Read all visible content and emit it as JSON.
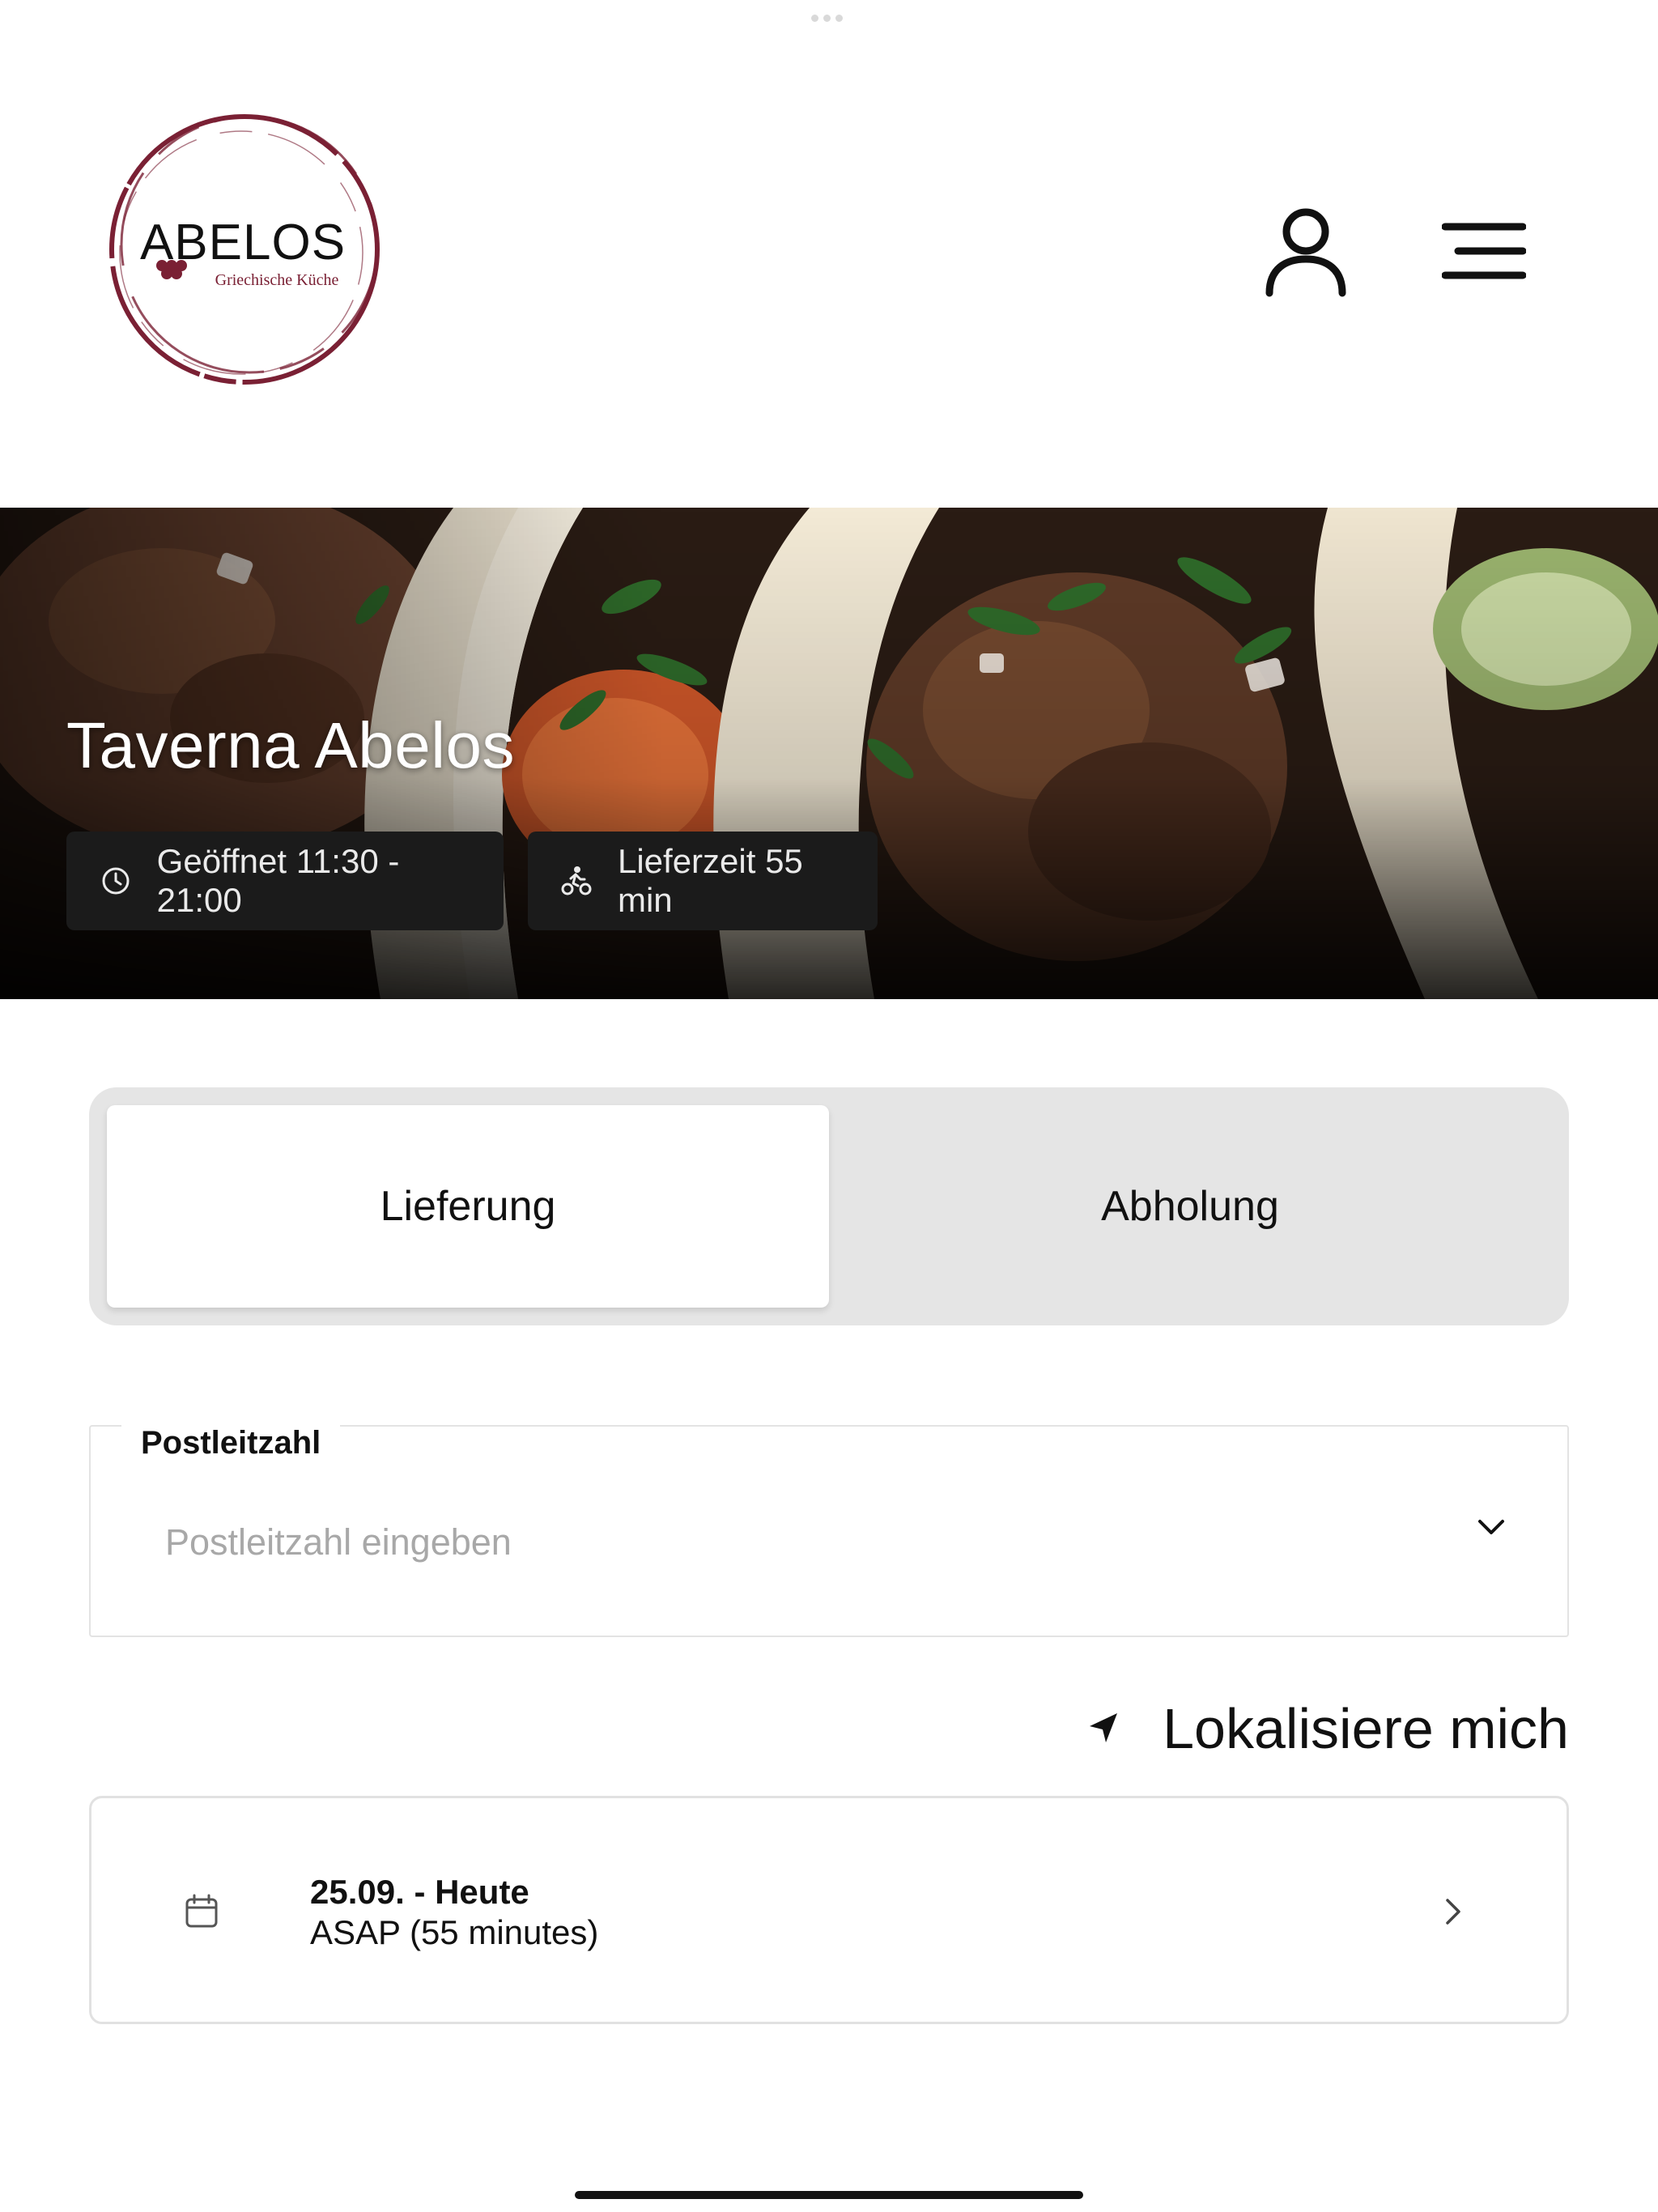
{
  "brand": {
    "logo_main": "ABELOS",
    "logo_sub": "Griechische Küche",
    "accent_color": "#7a2034"
  },
  "header": {
    "icons": [
      "user-icon",
      "menu-icon"
    ]
  },
  "hero": {
    "title": "Taverna Abelos",
    "opening_chip": "Geöffnet 11:30 - 21:00",
    "delivery_chip": "Lieferzeit 55 min"
  },
  "order_mode": {
    "options": [
      "Lieferung",
      "Abholung"
    ],
    "selected": "Lieferung"
  },
  "postcode": {
    "label": "Postleitzahl",
    "placeholder": "Postleitzahl eingeben",
    "value": ""
  },
  "locate": {
    "label": "Lokalisiere mich"
  },
  "schedule": {
    "date": "25.09. - Heute",
    "time": "ASAP (55 minutes)"
  }
}
